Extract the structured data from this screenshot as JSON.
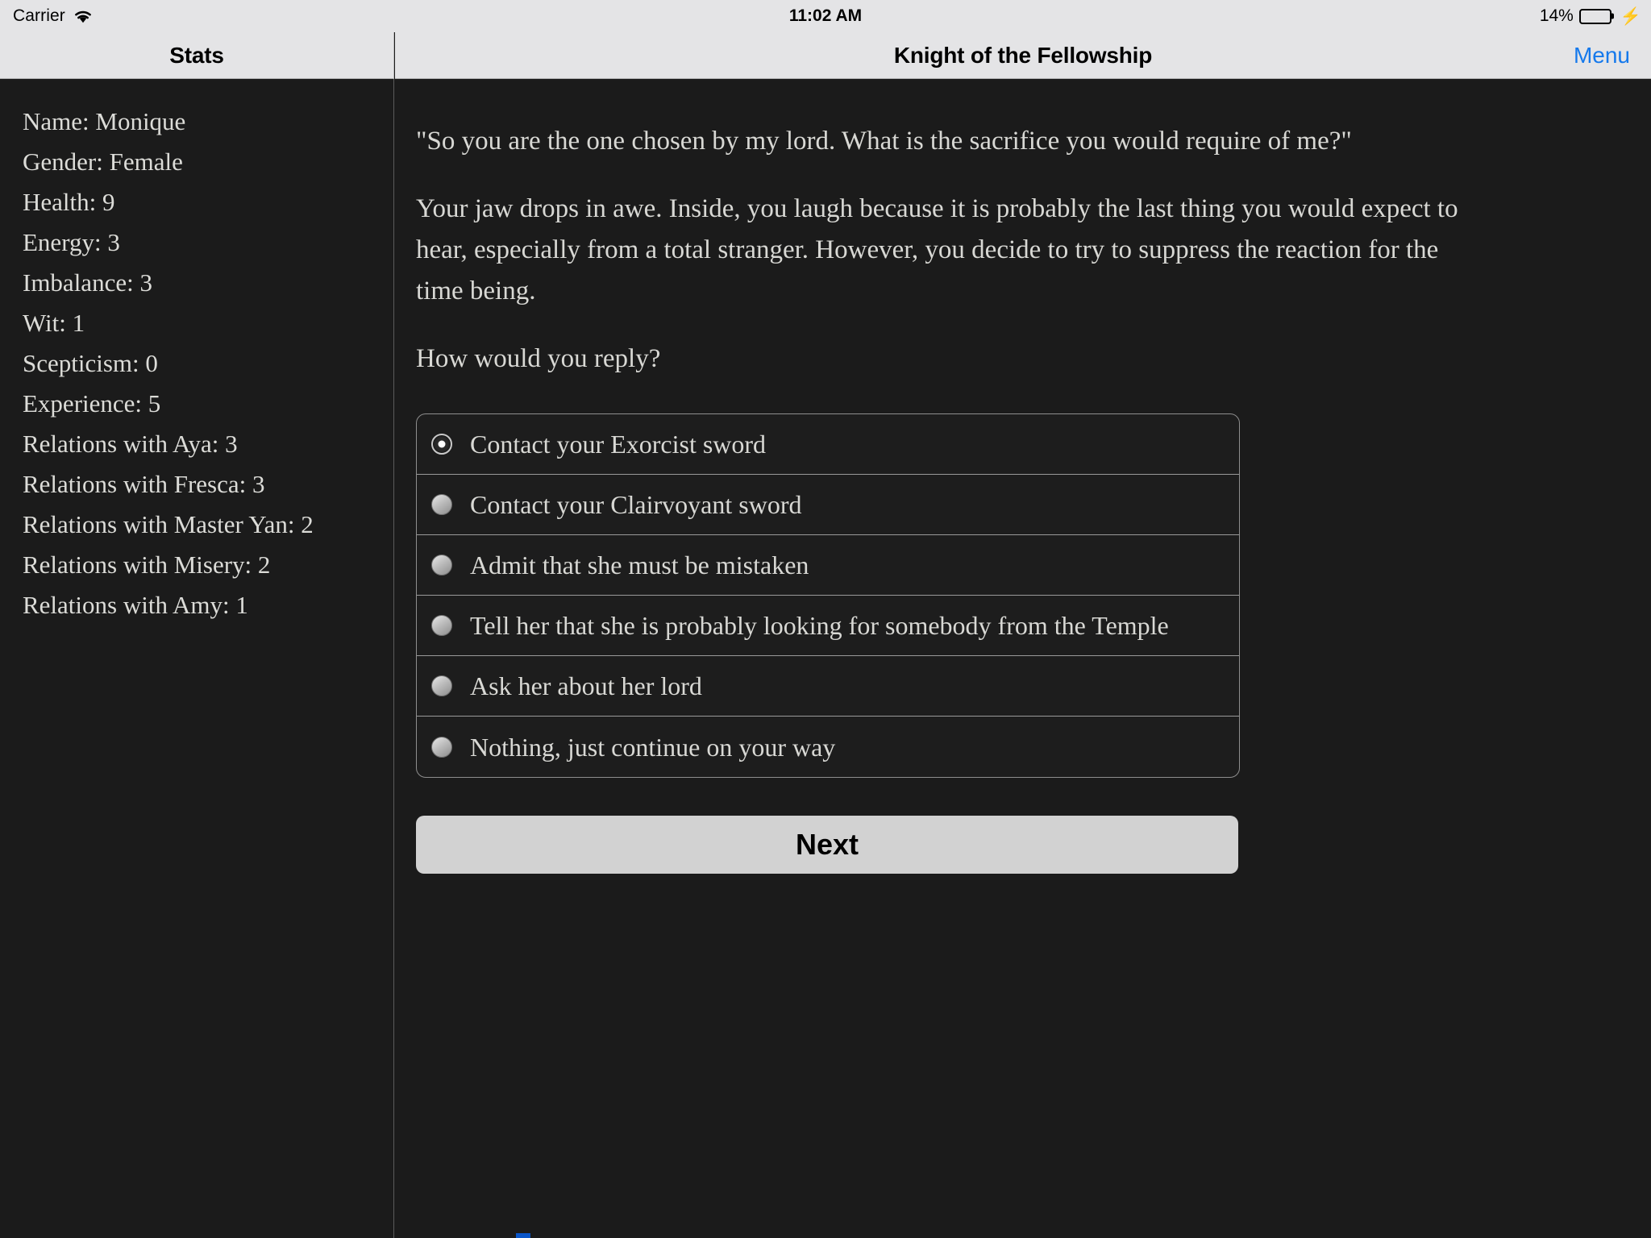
{
  "status_bar": {
    "carrier": "Carrier",
    "wifi_icon": "wifi-icon",
    "time": "11:02 AM",
    "battery_percent": "14%",
    "battery_level": 14,
    "battery_fill_color": "#4cd55a",
    "charging_icon": "bolt-icon"
  },
  "stats_panel": {
    "title": "Stats",
    "lines": [
      "Name: Monique",
      "Gender: Female",
      "Health: 9",
      "Energy: 3",
      "Imbalance: 3",
      "Wit: 1",
      "Scepticism: 0",
      "Experience: 5",
      "Relations with Aya: 3",
      "Relations with Fresca: 3",
      "Relations with Master Yan: 2",
      "Relations with Misery: 2",
      "Relations with Amy: 1"
    ]
  },
  "main_panel": {
    "title": "Knight of the Fellowship",
    "menu_label": "Menu",
    "menu_color": "#1579ec",
    "paragraphs": [
      "\"So you are the one chosen by my lord. What is the sacrifice you would require of me?\"",
      "Your jaw drops in awe. Inside, you laugh because it is probably the last thing you would expect to hear, especially from a total stranger. However, you decide to try to suppress the reaction for the time being.",
      "How would you reply?"
    ],
    "choices": [
      {
        "label": "Contact your Exorcist sword",
        "selected": true
      },
      {
        "label": "Contact your Clairvoyant sword",
        "selected": false
      },
      {
        "label": "Admit that she must be mistaken",
        "selected": false
      },
      {
        "label": "Tell her that she is probably looking for somebody from the Temple",
        "selected": false
      },
      {
        "label": "Ask her about her lord",
        "selected": false
      },
      {
        "label": "Nothing, just continue on your way",
        "selected": false
      }
    ],
    "next_label": "Next"
  }
}
